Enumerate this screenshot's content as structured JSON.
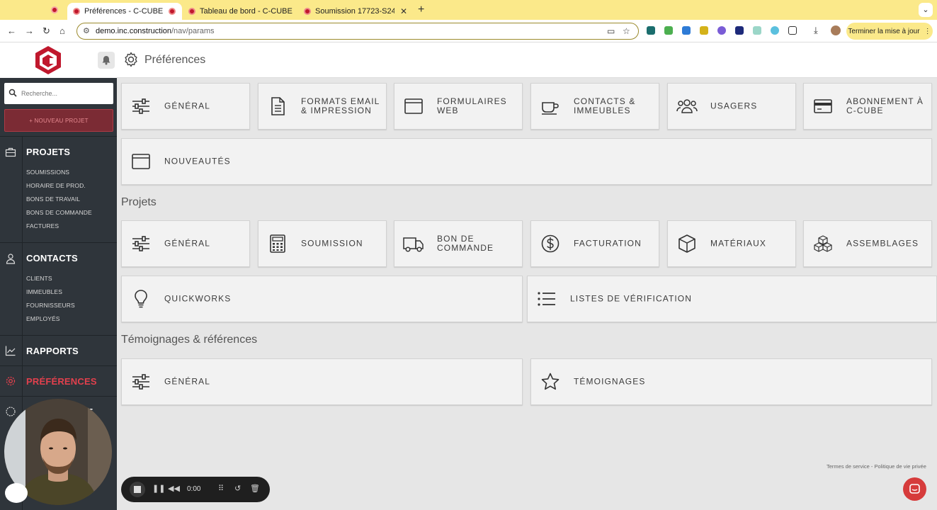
{
  "browser": {
    "tabs": [
      {
        "title": "Préférences - C-CUBE",
        "close": "✕"
      },
      {
        "title": "Tableau de bord - C-CUBE",
        "close": "✕"
      },
      {
        "title": "Soumission 17723-S24-1467",
        "close": "✕"
      }
    ],
    "new_tab": "+",
    "url_host": "demo.inc.construction",
    "url_path": "/nav/params",
    "update_button": "Terminer la mise à jour"
  },
  "header": {
    "title": "Préférences"
  },
  "sidebar": {
    "search_placeholder": "Recherche...",
    "new_project": "+ NOUVEAU PROJET",
    "sections": [
      {
        "title": "PROJETS",
        "items": [
          "SOUMISSIONS",
          "HORAIRE DE PROD.",
          "BONS DE TRAVAIL",
          "BONS DE COMMANDE",
          "FACTURES"
        ]
      },
      {
        "title": "CONTACTS",
        "items": [
          "CLIENTS",
          "IMMEUBLES",
          "FOURNISSEURS",
          "EMPLOYÉS"
        ]
      },
      {
        "title": "RAPPORTS",
        "items": []
      },
      {
        "title": "PRÉFÉRENCES",
        "items": []
      },
      {
        "title": "HE",
        "items": []
      }
    ]
  },
  "main": {
    "general_cards": [
      "GÉNÉRAL",
      "FORMATS EMAIL & IMPRESSION",
      "FORMULAIRES WEB",
      "CONTACTS & IMMEUBLES",
      "USAGERS",
      "ABONNEMENT À C-CUBE",
      "NOUVEAUTÉS"
    ],
    "projets_title": "Projets",
    "projets_cards": [
      "GÉNÉRAL",
      "SOUMISSION",
      "BON DE COMMANDE",
      "FACTURATION",
      "MATÉRIAUX",
      "ASSEMBLAGES",
      "QUICKWORKS",
      "LISTES DE VÉRIFICATION"
    ],
    "temoignages_title": "Témoignages & références",
    "temoignages_cards": [
      "GÉNÉRAL",
      "TÉMOIGNAGES"
    ]
  },
  "footer": {
    "links": "Termes de service - Politique de vie privée"
  },
  "recorder": {
    "time": "0:00"
  },
  "colors": {
    "accent": "#e2404d",
    "sidebar": "#2f353b",
    "tabbar": "#fbe98a"
  },
  "icons": [
    "sliders-icon",
    "document-icon",
    "browser-window-icon",
    "coffee-cup-icon",
    "users-icon",
    "credit-card-icon",
    "calculator-icon",
    "truck-icon",
    "dollar-circle-icon",
    "cube-icon",
    "cubes-icon",
    "lightbulb-icon",
    "list-icon",
    "star-icon",
    "gear-icon",
    "bell-icon",
    "search-icon"
  ]
}
